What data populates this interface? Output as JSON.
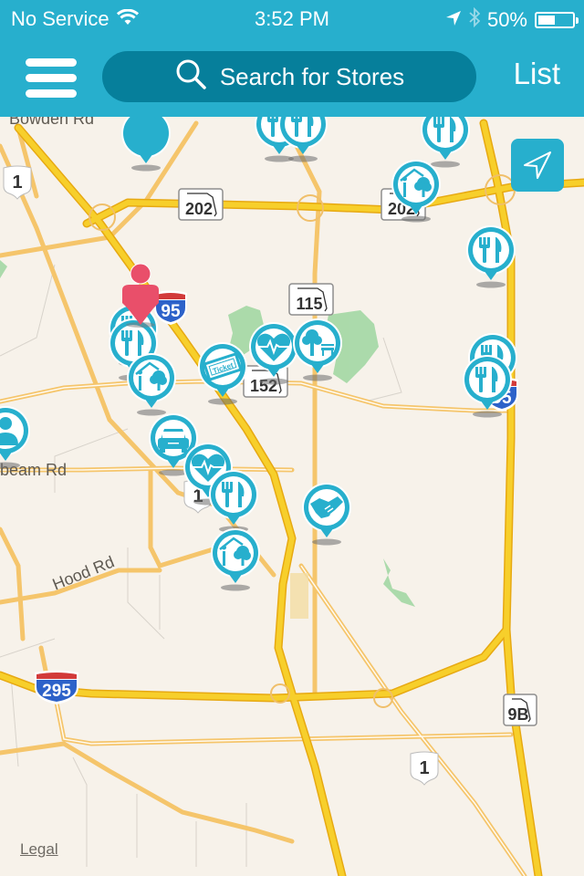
{
  "status_bar": {
    "carrier": "No Service",
    "time": "3:52 PM",
    "battery_percent": "50%",
    "battery_level": 0.5,
    "icons": [
      "wifi-icon",
      "location-arrow-icon",
      "bluetooth-icon",
      "battery-icon"
    ]
  },
  "nav_bar": {
    "menu_icon": "hamburger-menu-icon",
    "search_placeholder": "Search for Stores",
    "search_icon": "search-icon",
    "list_label": "List"
  },
  "map": {
    "locate_button_icon": "navigation-arrow-icon",
    "legal_label": "Legal",
    "road_labels": [
      "Bowden Rd",
      "beam Rd",
      "Hood Rd"
    ],
    "route_shields": [
      {
        "type": "us",
        "label": "1"
      },
      {
        "type": "state",
        "label": "202"
      },
      {
        "type": "state",
        "label": "202"
      },
      {
        "type": "interstate",
        "label": "95"
      },
      {
        "type": "state",
        "label": "115"
      },
      {
        "type": "state",
        "label": "152"
      },
      {
        "type": "interstate",
        "label": "95"
      },
      {
        "type": "us",
        "label": "1"
      },
      {
        "type": "interstate",
        "label": "295"
      },
      {
        "type": "state",
        "label": "9B"
      },
      {
        "type": "us",
        "label": "1"
      }
    ],
    "pins": [
      {
        "category": "restaurant",
        "icon": "fork-knife-icon"
      },
      {
        "category": "restaurant",
        "icon": "fork-knife-icon"
      },
      {
        "category": "restaurant",
        "icon": "fork-knife-icon"
      },
      {
        "category": "selected",
        "icon": "blank-pin-icon"
      },
      {
        "category": "home-garden",
        "icon": "house-tree-icon"
      },
      {
        "category": "restaurant",
        "icon": "fork-knife-icon"
      },
      {
        "category": "restaurant",
        "icon": "fork-knife-icon"
      },
      {
        "category": "restaurant",
        "icon": "fork-knife-icon"
      },
      {
        "category": "home-garden",
        "icon": "house-tree-icon"
      },
      {
        "category": "entertainment",
        "icon": "ticket-icon",
        "text": "Ticket"
      },
      {
        "category": "health",
        "icon": "heart-pulse-icon"
      },
      {
        "category": "parks",
        "icon": "tree-bench-icon"
      },
      {
        "category": "restaurant",
        "icon": "fork-knife-icon"
      },
      {
        "category": "restaurant",
        "icon": "fork-knife-icon"
      },
      {
        "category": "services",
        "icon": "person-icon"
      },
      {
        "category": "auto",
        "icon": "car-icon"
      },
      {
        "category": "health",
        "icon": "heart-pulse-icon"
      },
      {
        "category": "restaurant",
        "icon": "fork-knife-icon"
      },
      {
        "category": "home-garden",
        "icon": "house-tree-icon"
      },
      {
        "category": "business",
        "icon": "handshake-icon"
      }
    ],
    "user_location_icon": "user-location-person-icon"
  },
  "colors": {
    "brand": "#27afcd",
    "search_bg": "#067f9b",
    "user_marker": "#e94f6a",
    "map_bg": "#f7f2ea",
    "highway": "#f6c31b",
    "park": "#9ed6a0"
  }
}
